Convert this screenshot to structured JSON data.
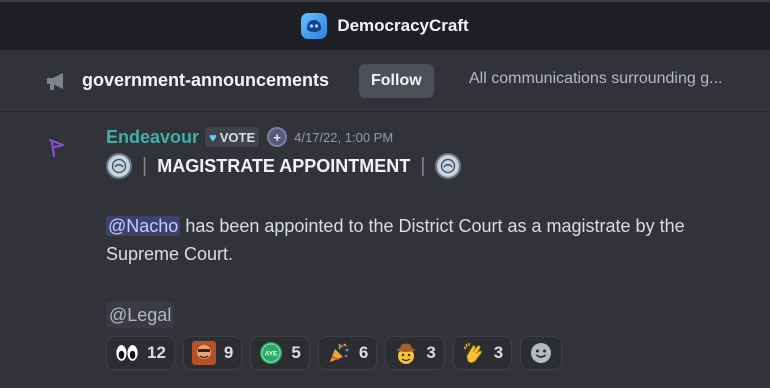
{
  "server": {
    "name": "DemocracyCraft",
    "icon": "server-logo-icon",
    "accent": "#3b9cf0"
  },
  "channel": {
    "icon": "megaphone-icon",
    "name": "government-announcements",
    "follow_label": "Follow",
    "topic": "All communications surrounding g..."
  },
  "message": {
    "author": "Endeavour",
    "author_color": "#3fb0a6",
    "role_badge": "VOTE",
    "timestamp": "4/17/22, 1:00 PM",
    "heading_separator_left": "|",
    "heading": "MAGISTRATE APPOINTMENT",
    "heading_separator_right": "|",
    "mention": "@Nacho",
    "body": " has been appointed to the District Court as a magistrate by the Supreme Court.",
    "role_mention": "@Legal"
  },
  "reactions": [
    {
      "emoji": "eyes-emoji",
      "count": "12"
    },
    {
      "emoji": "custom-face-emoji",
      "count": "9"
    },
    {
      "emoji": "aye-emoji",
      "count": "5"
    },
    {
      "emoji": "party-popper-emoji",
      "count": "6"
    },
    {
      "emoji": "cowboy-emoji",
      "count": "3"
    },
    {
      "emoji": "clapping-hands-emoji",
      "count": "3"
    }
  ],
  "add_reaction_icon": "add-reaction-icon"
}
